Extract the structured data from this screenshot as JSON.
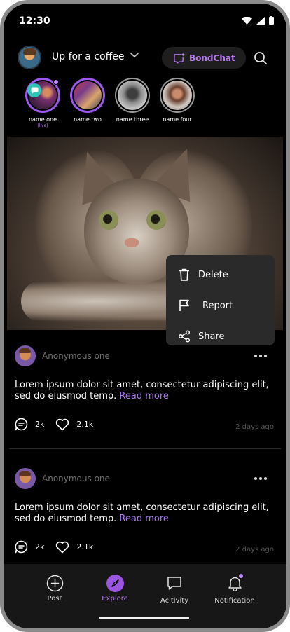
{
  "status_bar": {
    "time": "12:30"
  },
  "header": {
    "title": "Up for a coffee",
    "bond_button_label": "BondChat"
  },
  "stories": [
    {
      "name": "name one",
      "sub": "(live)"
    },
    {
      "name": "name two",
      "sub": ""
    },
    {
      "name": "name three",
      "sub": ""
    },
    {
      "name": "name four",
      "sub": ""
    }
  ],
  "context_menu": {
    "items": [
      {
        "label": "Delete",
        "icon": "trash-icon"
      },
      {
        "label": "Report",
        "icon": "flag-icon"
      },
      {
        "label": "Share",
        "icon": "share-icon"
      }
    ]
  },
  "posts": [
    {
      "author": "Anonymous one",
      "text": "Lorem ipsum dolor sit amet, consectetur adipiscing elit, sed do eiusmod temp.",
      "read_more": "Read more",
      "comments": "2k",
      "likes": "2.1k",
      "time": "2 days ago"
    },
    {
      "author": "Anonymous one",
      "text": "Lorem ipsum dolor sit amet, consectetur adipiscing elit, sed do eiusmod temp.",
      "read_more": "Read more",
      "comments": "2k",
      "likes": "2.1k",
      "time": "2 days ago"
    }
  ],
  "bottom_nav": [
    {
      "label": "Post",
      "icon": "plus-circle-icon"
    },
    {
      "label": "Explore",
      "icon": "compass-icon"
    },
    {
      "label": "Acitivity",
      "icon": "chat-bubble-icon"
    },
    {
      "label": "Notification",
      "icon": "bell-icon"
    }
  ],
  "colors": {
    "accent": "#9b56e0",
    "accent_text": "#b57cf0",
    "background": "#000000",
    "menu_background": "#2a2a2a",
    "nav_background": "#171717"
  }
}
